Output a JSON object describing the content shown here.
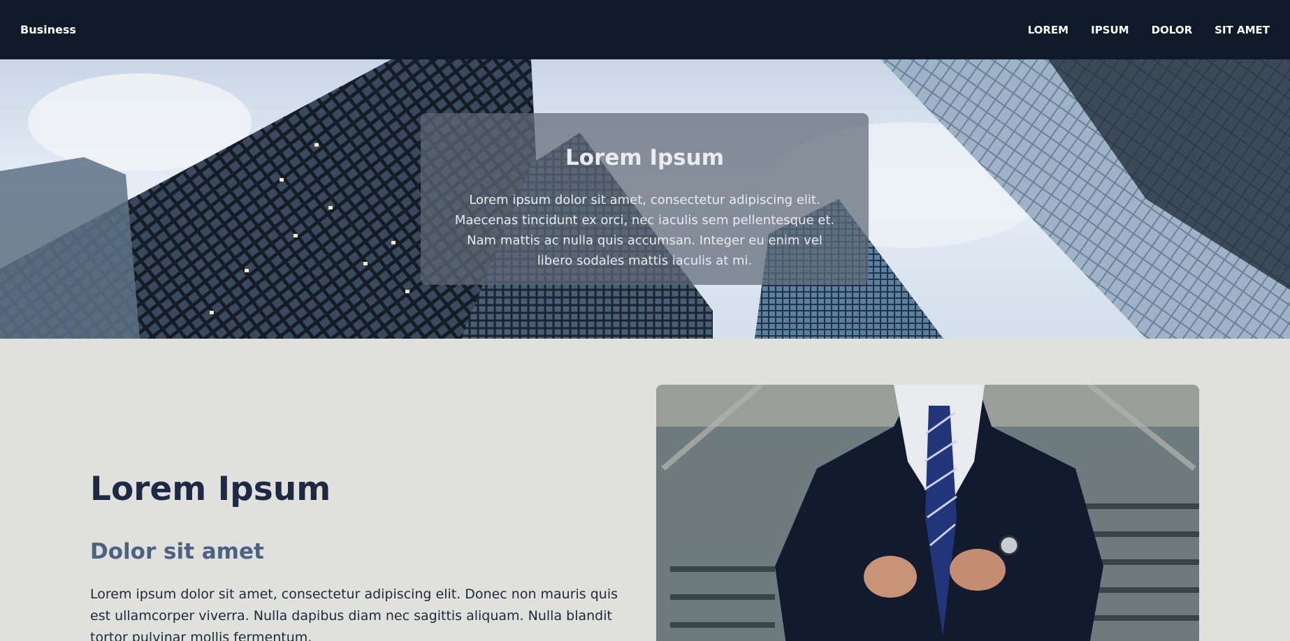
{
  "navbar": {
    "brand": "Business",
    "links": [
      "LOREM",
      "IPSUM",
      "DOLOR",
      "SIT AMET"
    ]
  },
  "hero": {
    "title": "Lorem Ipsum",
    "text": "Lorem ipsum dolor sit amet, consectetur adipiscing elit. Maecenas tincidunt ex orci, nec iaculis sem pellentesque et. Nam mattis ac nulla quis accumsan. Integer eu enim vel libero sodales mattis iaculis at mi."
  },
  "section": {
    "heading": "Lorem Ipsum",
    "subheading": "Dolor sit amet",
    "paragraph": "Lorem ipsum dolor sit amet, consectetur adipiscing elit. Donec non mauris quis est ullamcorper viverra. Nulla dapibus diam nec sagittis aliquam. Nulla blandit tortor pulvinar mollis fermentum."
  },
  "colors": {
    "navbar_bg": "#0e1a2a",
    "page_bg": "#e0e0dc",
    "heading": "#1e2a44",
    "subheading": "#4d6282"
  },
  "images": {
    "hero_background": "skyscrapers-looking-up",
    "section_photo": "businessman-in-suit"
  }
}
